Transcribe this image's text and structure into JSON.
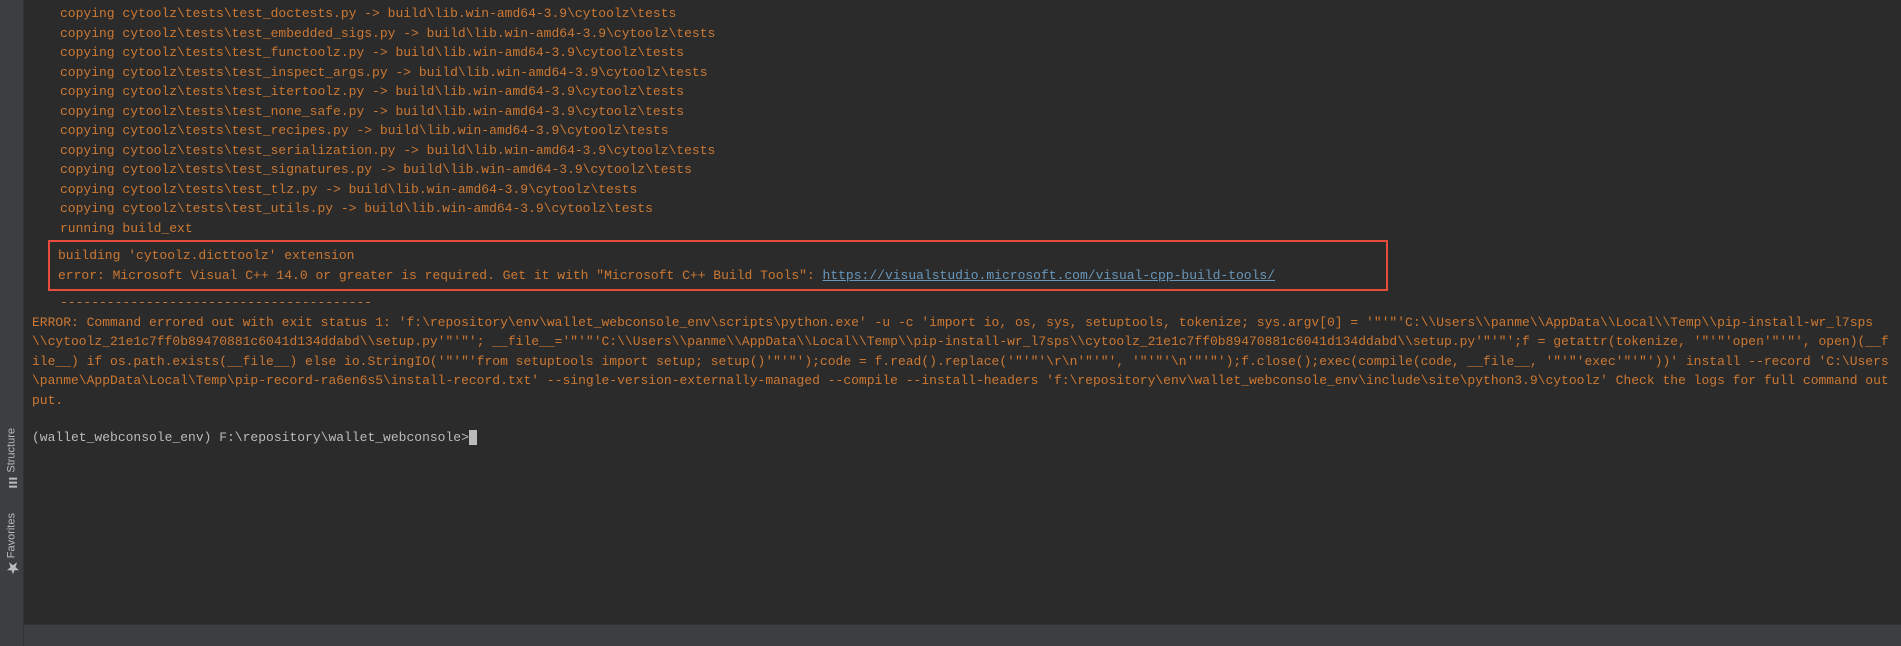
{
  "sidebar": {
    "items": [
      {
        "label": "Structure",
        "icon": "structure"
      },
      {
        "label": "Favorites",
        "icon": "star"
      }
    ]
  },
  "terminal": {
    "copyLines": [
      "copying cytoolz\\tests\\test_doctests.py -> build\\lib.win-amd64-3.9\\cytoolz\\tests",
      "copying cytoolz\\tests\\test_embedded_sigs.py -> build\\lib.win-amd64-3.9\\cytoolz\\tests",
      "copying cytoolz\\tests\\test_functoolz.py -> build\\lib.win-amd64-3.9\\cytoolz\\tests",
      "copying cytoolz\\tests\\test_inspect_args.py -> build\\lib.win-amd64-3.9\\cytoolz\\tests",
      "copying cytoolz\\tests\\test_itertoolz.py -> build\\lib.win-amd64-3.9\\cytoolz\\tests",
      "copying cytoolz\\tests\\test_none_safe.py -> build\\lib.win-amd64-3.9\\cytoolz\\tests",
      "copying cytoolz\\tests\\test_recipes.py -> build\\lib.win-amd64-3.9\\cytoolz\\tests",
      "copying cytoolz\\tests\\test_serialization.py -> build\\lib.win-amd64-3.9\\cytoolz\\tests",
      "copying cytoolz\\tests\\test_signatures.py -> build\\lib.win-amd64-3.9\\cytoolz\\tests",
      "copying cytoolz\\tests\\test_tlz.py -> build\\lib.win-amd64-3.9\\cytoolz\\tests",
      "copying cytoolz\\tests\\test_utils.py -> build\\lib.win-amd64-3.9\\cytoolz\\tests",
      "running build_ext"
    ],
    "highlighted": {
      "line1": "building 'cytoolz.dicttoolz' extension",
      "line2Prefix": "error: Microsoft Visual C++ 14.0 or greater is required. Get it with \"Microsoft C++ Build Tools\": ",
      "link": "https://visualstudio.microsoft.com/visual-cpp-build-tools/"
    },
    "dashLine": "----------------------------------------",
    "errorBlock": "ERROR: Command errored out with exit status 1: 'f:\\repository\\env\\wallet_webconsole_env\\scripts\\python.exe' -u -c 'import io, os, sys, setuptools, tokenize; sys.argv[0] = '\"'\"'C:\\\\Users\\\\panme\\\\AppData\\\\Local\\\\Temp\\\\pip-install-wr_l7sps\\\\cytoolz_21e1c7ff0b89470881c6041d134ddabd\\\\setup.py'\"'\"'; __file__='\"'\"'C:\\\\Users\\\\panme\\\\AppData\\\\Local\\\\Temp\\\\pip-install-wr_l7sps\\\\cytoolz_21e1c7ff0b89470881c6041d134ddabd\\\\setup.py'\"'\"';f = getattr(tokenize, '\"'\"'open'\"'\"', open)(__file__) if os.path.exists(__file__) else io.StringIO('\"'\"'from setuptools import setup; setup()'\"'\"');code = f.read().replace('\"'\"'\\r\\n'\"'\"', '\"'\"'\\n'\"'\"');f.close();exec(compile(code, __file__, '\"'\"'exec'\"'\"'))' install --record 'C:\\Users\\panme\\AppData\\Local\\Temp\\pip-record-ra6en6s5\\install-record.txt' --single-version-externally-managed --compile --install-headers 'f:\\repository\\env\\wallet_webconsole_env\\include\\site\\python3.9\\cytoolz' Check the logs for full command output.",
    "prompt": "(wallet_webconsole_env) F:\\repository\\wallet_webconsole>"
  }
}
